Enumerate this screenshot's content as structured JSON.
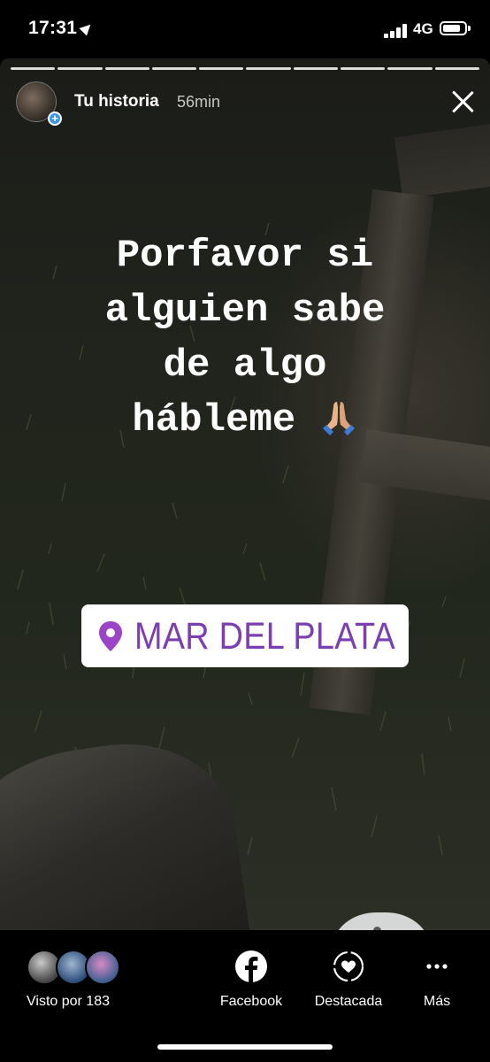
{
  "status_bar": {
    "time": "17:31",
    "network": "4G"
  },
  "story": {
    "username": "Tu historia",
    "elapsed": "56min",
    "segments": 10,
    "caption_lines": [
      "Porfavor si",
      "alguien sabe",
      "de algo",
      "hábleme"
    ],
    "caption_emoji": "folded-hands-icon",
    "location_sticker": "MAR DEL PLATA"
  },
  "bottom_bar": {
    "viewers_label": "Visto por 183",
    "actions": [
      {
        "label": "Facebook",
        "icon": "facebook-icon"
      },
      {
        "label": "Destacada",
        "icon": "highlight-heart-icon"
      },
      {
        "label": "Más",
        "icon": "more-dots-icon"
      }
    ]
  },
  "colors": {
    "location_text": "#7b3fb2",
    "pin": "#9c44c7",
    "avatar_badge": "#3797f0"
  }
}
